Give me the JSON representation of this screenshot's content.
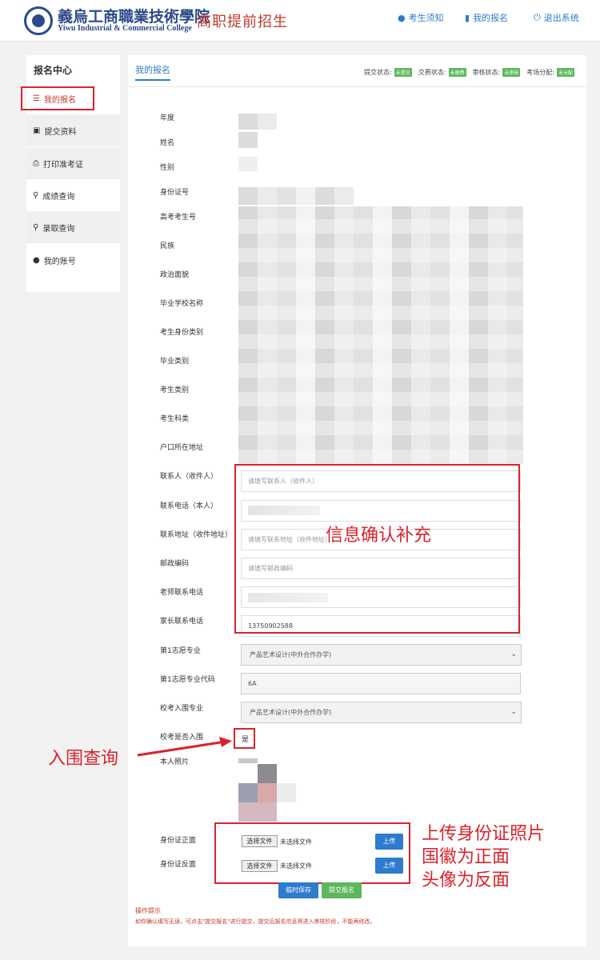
{
  "header": {
    "school_cn": "義烏工商職業技術學院",
    "school_en": "Yiwu Industrial & Commercial College",
    "title": "高职提前招生",
    "nav": [
      "考生须知",
      "我的报名",
      "退出系统"
    ]
  },
  "sidebar": {
    "title": "报名中心",
    "items": [
      "我的报名",
      "提交资料",
      "打印准考证",
      "成绩查询",
      "录取查询",
      "我的账号"
    ]
  },
  "main": {
    "tab": "我的报名",
    "status": [
      {
        "label": "提交状态:",
        "badge": "未提交"
      },
      {
        "label": "交费状态:",
        "badge": "未缴费"
      },
      {
        "label": "审核状态:",
        "badge": "未审核"
      },
      {
        "label": "考场分配:",
        "badge": "未分配"
      }
    ]
  },
  "form": {
    "labels": [
      "年度",
      "姓名",
      "性别",
      "身份证号",
      "高考考生号",
      "民族",
      "政治面貌",
      "毕业学校名称",
      "考生身份类别",
      "毕业类别",
      "考生类别",
      "考生科类",
      "户口所在地址",
      "联系人（收件人）",
      "联系电话（本人）",
      "联系地址（收件地址）",
      "邮政编码",
      "老师联系电话",
      "家长联系电话",
      "第1志愿专业",
      "第1志愿专业代码",
      "校考入围专业",
      "校考是否入围",
      "本人照片",
      "身份证正面",
      "身份证反面"
    ],
    "contact_placeholder": "请填写联系人（收件人）",
    "address_placeholder": "请填写联系地址（收件地址）",
    "zip_placeholder": "请填写邮政编码",
    "parent_phone_partial": "13750902588",
    "major1": "产品艺术设计(中外合作办学)",
    "major1_code": "6A",
    "shortlist_major": "产品艺术设计(中外合作办学)",
    "shortlisted": "是",
    "choose_file": "选择文件",
    "no_file": "未选择文件",
    "upload": "上传",
    "save": "临时保存",
    "submit": "提交报名",
    "tip_title": "操作提示",
    "tip_text": "如你确认填写无误，可点击\"提交报名\"进行提交，提交后报名信息将进入审核阶段，不能再修改。"
  },
  "annotations": {
    "info": "信息确认补充",
    "shortlist": "入围查询",
    "id_line1": "上传身份证照片",
    "id_line2": "国徽为正面",
    "id_line3": "头像为反面"
  },
  "colors": {
    "accent": "#2e7bcf",
    "annotation": "#d9232d",
    "success": "#5cb85c"
  }
}
